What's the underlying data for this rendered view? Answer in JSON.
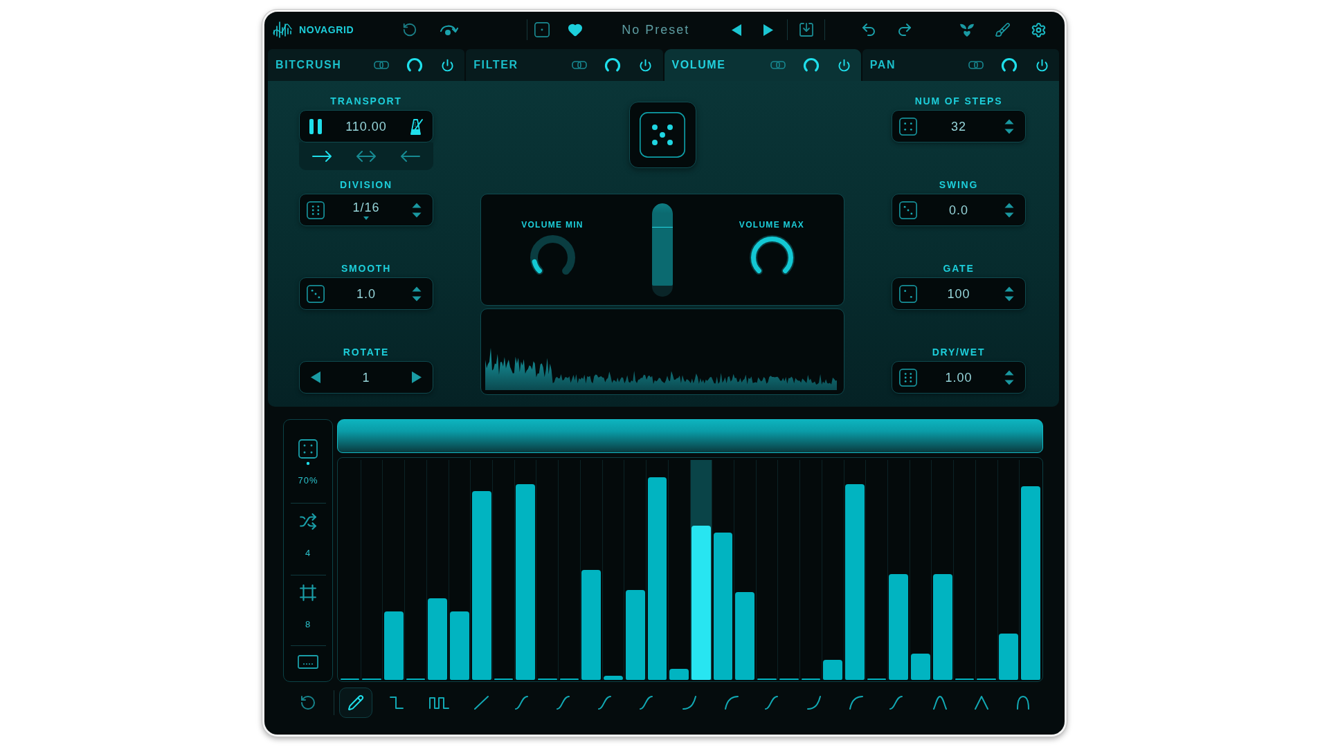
{
  "app": {
    "name": "NOVAGRID"
  },
  "preset": {
    "name": "No Preset",
    "favorite": true
  },
  "modules": [
    {
      "label": "BITCRUSH",
      "selected": false,
      "on": true
    },
    {
      "label": "FILTER",
      "selected": false,
      "on": true
    },
    {
      "label": "VOLUME",
      "selected": true,
      "on": true
    },
    {
      "label": "PAN",
      "selected": false,
      "on": true
    }
  ],
  "transport": {
    "label": "TRANSPORT",
    "playing": true,
    "tempo": "110.00",
    "directions": [
      {
        "kind": "forward",
        "selected": true
      },
      {
        "kind": "pingpong",
        "selected": false
      },
      {
        "kind": "backward",
        "selected": false
      }
    ]
  },
  "left_controls": [
    {
      "kind": "select",
      "label": "DIVISION",
      "value": "1/16"
    },
    {
      "kind": "spin",
      "label": "SMOOTH",
      "value": "1.0"
    },
    {
      "kind": "stepper",
      "label": "ROTATE",
      "value": "1"
    }
  ],
  "right_controls": [
    {
      "kind": "spin",
      "label": "NUM OF STEPS",
      "value": "32"
    },
    {
      "kind": "spin",
      "label": "SWING",
      "value": "0.0"
    },
    {
      "kind": "spin",
      "label": "GATE",
      "value": "100"
    },
    {
      "kind": "spin",
      "label": "DRY/WET",
      "value": "1.00"
    }
  ],
  "volume": {
    "knobs": [
      {
        "label": "VOLUME MIN",
        "level": 0.12
      },
      {
        "label": "VOLUME MAX",
        "level": 1
      }
    ],
    "slider": {
      "level": 0.74
    }
  },
  "sequencer": {
    "side": [
      {
        "kind": "random",
        "value": "70%"
      },
      {
        "kind": "shuffle",
        "value": "4"
      },
      {
        "kind": "grid",
        "value": "8"
      },
      {
        "kind": "keyboard"
      }
    ],
    "steps": [
      {
        "level": 0,
        "active": false
      },
      {
        "level": 0,
        "active": false
      },
      {
        "level": 0.31,
        "active": false
      },
      {
        "level": 0,
        "active": false
      },
      {
        "level": 0.37,
        "active": false
      },
      {
        "level": 0.31,
        "active": false
      },
      {
        "level": 0.86,
        "active": false
      },
      {
        "level": 0,
        "active": false
      },
      {
        "level": 0.89,
        "active": false
      },
      {
        "level": 0,
        "active": false
      },
      {
        "level": 0,
        "active": false
      },
      {
        "level": 0.5,
        "active": false
      },
      {
        "level": 0.02,
        "active": false
      },
      {
        "level": 0.41,
        "active": false
      },
      {
        "level": 0.92,
        "active": false
      },
      {
        "level": 0.05,
        "active": false
      },
      {
        "level": 0.7,
        "active": true
      },
      {
        "level": 0.67,
        "active": false
      },
      {
        "level": 0.4,
        "active": false
      },
      {
        "level": 0,
        "active": false
      },
      {
        "level": 0,
        "active": false
      },
      {
        "level": 0,
        "active": false
      },
      {
        "level": 0.09,
        "active": false
      },
      {
        "level": 0.89,
        "active": false
      },
      {
        "level": 0,
        "active": false
      },
      {
        "level": 0.48,
        "active": false
      },
      {
        "level": 0.12,
        "active": false
      },
      {
        "level": 0.48,
        "active": false
      },
      {
        "level": 0,
        "active": false
      },
      {
        "level": 0,
        "active": false
      },
      {
        "level": 0.21,
        "active": false
      },
      {
        "level": 0.88,
        "active": false
      }
    ],
    "tools": [
      {
        "kind": "pencil",
        "selected": true
      },
      {
        "kind": "step",
        "selected": false
      },
      {
        "kind": "pulse",
        "selected": false
      },
      {
        "kind": "ramp",
        "selected": false
      },
      {
        "kind": "s-curve",
        "selected": false
      },
      {
        "kind": "s-curve",
        "selected": false
      },
      {
        "kind": "s-curve",
        "selected": false
      },
      {
        "kind": "s-curve",
        "selected": false
      },
      {
        "kind": "ease-in",
        "selected": false
      },
      {
        "kind": "ease-out",
        "selected": false
      },
      {
        "kind": "s-curve",
        "selected": false
      },
      {
        "kind": "ease-in",
        "selected": false
      },
      {
        "kind": "ease-out",
        "selected": false
      },
      {
        "kind": "s-curve",
        "selected": false
      },
      {
        "kind": "bell",
        "selected": false
      },
      {
        "kind": "triangle",
        "selected": false
      },
      {
        "kind": "arch",
        "selected": false
      }
    ]
  }
}
